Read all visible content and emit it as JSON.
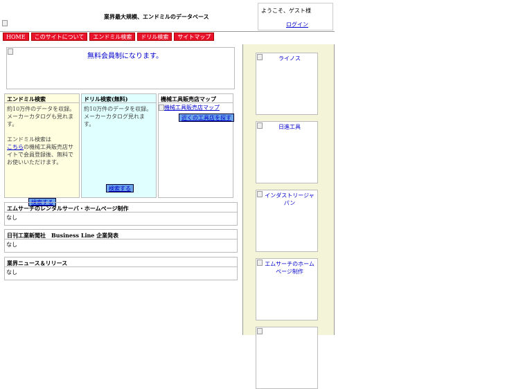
{
  "header": {
    "tagline": "業界最大規模、エンドミルのデータベース",
    "welcome": "ようこそ、ゲスト様",
    "login_link": "ログイン"
  },
  "nav": [
    "HOME",
    "このサイトについて",
    "エンドミル検索",
    "ドリル検索",
    "サイトマップ"
  ],
  "promo": {
    "text": "無料会員制になります。"
  },
  "columns": {
    "endmill": {
      "title": "エンドミル検索",
      "desc": "約10万件のデータを収録。メーカーカタログも見れます。",
      "note_prefix": "エンドミル検索は",
      "note_link": "こちら",
      "note_suffix": "の機械工具販売店サイトで会員登録後、無料でお使いいただけます。",
      "button": "検索する"
    },
    "drill": {
      "title": "ドリル検索(無料)",
      "desc": "約10万件のデータを収録。メーカーカタログ見れます。",
      "button": "検索する"
    },
    "map": {
      "title": "機械工具販売店マップ",
      "image_alt": "機械工具販売店マップ",
      "button": "近くの工具店を探す"
    }
  },
  "news_boxes": [
    {
      "title": "エムサーチのレンタルサーバ・ホームページ制作",
      "body": "なし"
    },
    {
      "title": "日刊工業新聞社　Business Line 企業発表",
      "body": "なし"
    },
    {
      "title": "業界ニュース＆リリース",
      "body": "なし"
    }
  ],
  "sidebar": {
    "banners": [
      "ライノス",
      "日進工具",
      "インダストリージャパン",
      "エムサーチのホームページ制作",
      ""
    ]
  }
}
